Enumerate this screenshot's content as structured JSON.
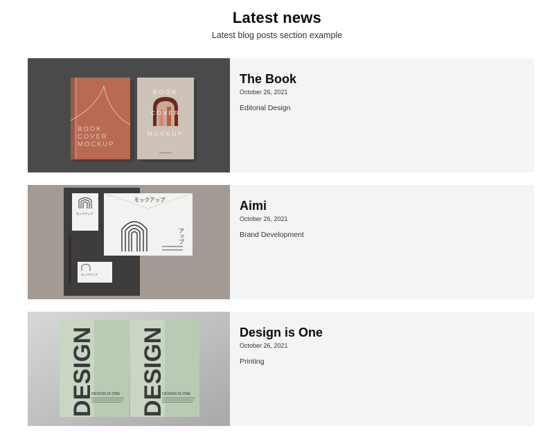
{
  "header": {
    "title": "Latest news",
    "subtitle": "Latest blog posts section example"
  },
  "posts": [
    {
      "title": "The Book",
      "date": "October 26, 2021",
      "category": "Editorial Design",
      "image": {
        "book_left_lines": [
          "BOOK",
          "COVER",
          "MOCKUP"
        ],
        "book_right_top": "BOOK",
        "book_right_mid": "COVER",
        "book_right_bottom": "MOCKUP"
      }
    },
    {
      "title": "Aimi",
      "date": "October 26, 2021",
      "category": "Brand Development",
      "image": {
        "envelope_heading": "モックアップ",
        "envelope_vertical": "アップ",
        "card_label": "モックアップ"
      }
    },
    {
      "title": "Design is One",
      "date": "October 26, 2021",
      "category": "Printing",
      "image": {
        "poster_word": "DESIGN",
        "poster_caption": "DESIGN IS ONE"
      }
    }
  ]
}
